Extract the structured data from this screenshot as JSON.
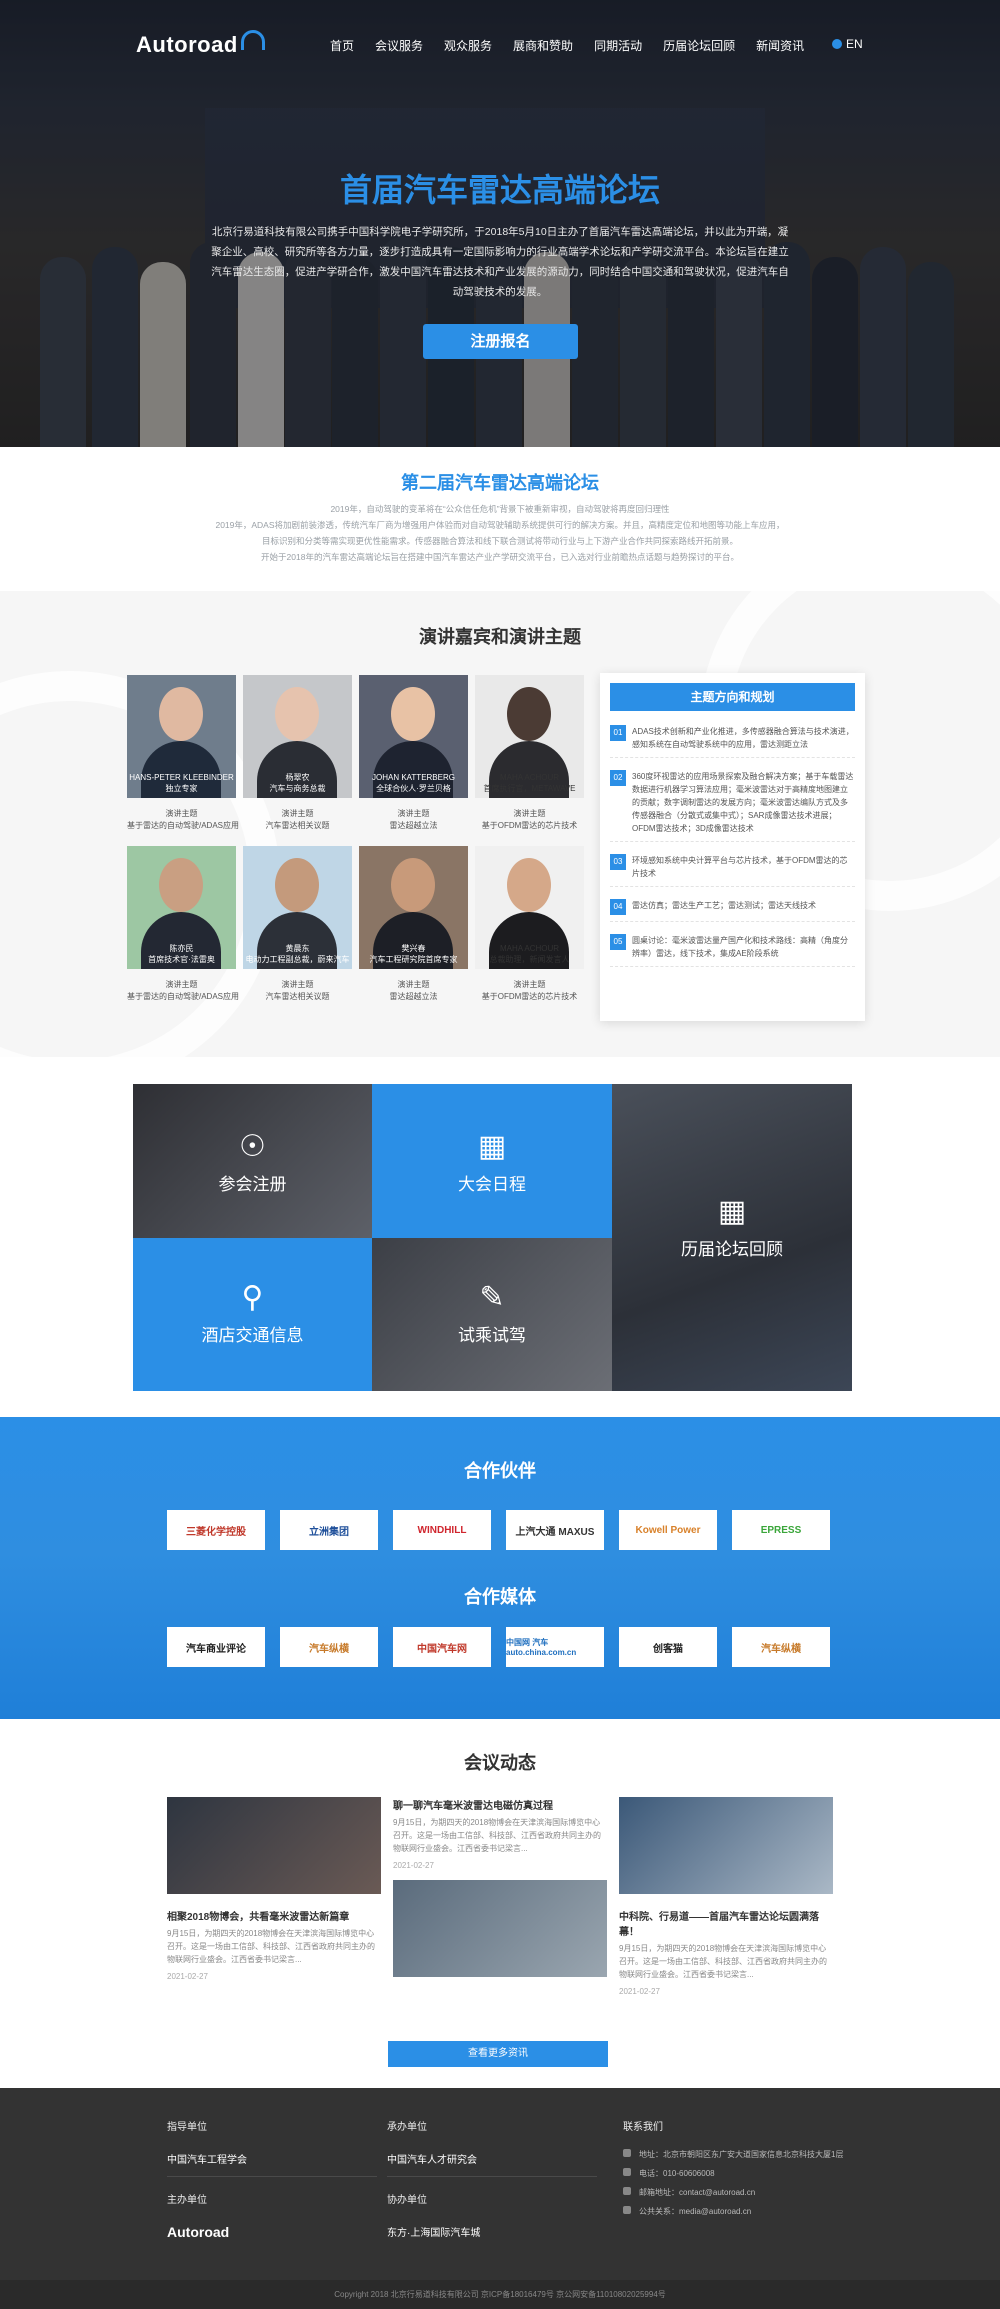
{
  "nav": {
    "logo": "Autoroad",
    "items": [
      "首页",
      "会议服务",
      "观众服务",
      "展商和赞助",
      "同期活动",
      "历届论坛回顾",
      "新闻资讯"
    ],
    "lang": "EN"
  },
  "hero": {
    "title": "首届汽车雷达高端论坛",
    "desc": "北京行易道科技有限公司携手中国科学院电子学研究所，于2018年5月10日主办了首届汽车雷达高端论坛，并以此为开端，凝聚企业、高校、研究所等各方力量，逐步打造成具有一定国际影响力的行业高端学术论坛和产学研交流平台。本论坛旨在建立汽车雷达生态圈，促进产学研合作，激发中国汽车雷达技术和产业发展的源动力，同时结合中国交通和驾驶状况，促进汽车自动驾驶技术的发展。",
    "button": "注册报名"
  },
  "second": {
    "title": "第二届汽车雷达高端论坛",
    "lines": [
      "2019年，自动驾驶的变革将在“公众信任危机”背景下被重新审视，自动驾驶将再度回归理性",
      "2019年，ADAS将加剧前装渗透，传统汽车厂商为增强用户体验而对自动驾驶辅助系统提供可行的解决方案。并且，高精度定位和地图等功能上车应用，",
      "目标识别和分类等需实现更优性能需求。传感器融合算法和线下联合测试将带动行业与上下游产业合作共同探索路线开拓前景。",
      "开始于2018年的汽车雷达高端论坛旨在搭建中国汽车雷达产业产学研交流平台，已入选对行业前瞻热点话题与趋势探讨的平台。"
    ]
  },
  "speakers": {
    "title": "演讲嘉宾和演讲主题",
    "list": [
      {
        "name": "HANS-PETER KLEEBINDER",
        "role": "独立专家",
        "m1": "演讲主题",
        "m2": "基于雷达的自动驾驶/ADAS应用"
      },
      {
        "name": "杨翠农",
        "role": "汽车与商务总裁",
        "m1": "演讲主题",
        "m2": "汽车雷达相关议题"
      },
      {
        "name": "JOHAN KATTERBERG",
        "role": "全球合伙人·罗兰贝格",
        "m1": "演讲主题",
        "m2": "雷达超越立法"
      },
      {
        "name": "MAHA ACHOUR",
        "role": "首席执行官，METAWAVE",
        "m1": "演讲主题",
        "m2": "基于OFDM雷达的芯片技术"
      },
      {
        "name": "陈亦民",
        "role": "首席技术官·法雷奥",
        "m1": "演讲主题",
        "m2": "基于雷达的自动驾驶/ADAS应用"
      },
      {
        "name": "黄晨东",
        "role": "电动力工程副总裁，蔚来汽车",
        "m1": "演讲主题",
        "m2": "汽车雷达相关议题"
      },
      {
        "name": "樊兴春",
        "role": "汽车工程研究院首席专家",
        "m1": "演讲主题",
        "m2": "雷达超越立法"
      },
      {
        "name": "MAHA ACHOUR",
        "role": "总裁助理，新闻发言人",
        "m1": "演讲主题",
        "m2": "基于OFDM雷达的芯片技术"
      }
    ],
    "topics_title": "主题方向和规划",
    "topics": [
      {
        "num": "01",
        "text": "ADAS技术创新和产业化推进，多传感器融合算法与技术演进，感知系统在自动驾驶系统中的应用，雷达测距立法"
      },
      {
        "num": "02",
        "text": "360度环视雷达的应用场景探索及融合解决方案；基于车载雷达数据进行机器学习算法应用；毫米波雷达对于高精度地图建立的贡献；数字调制雷达的发展方向；毫米波雷达编队方式及多传感器融合（分散式或集中式）；SAR成像雷达技术进展；OFDM雷达技术；3D成像雷达技术"
      },
      {
        "num": "03",
        "text": "环境感知系统中央计算平台与芯片技术，基于OFDM雷达的芯片技术"
      },
      {
        "num": "04",
        "text": "雷达仿真；雷达生产工艺；雷达测试；雷达天线技术"
      },
      {
        "num": "05",
        "text": "圆桌讨论：毫米波雷达量产国产化和技术路线：高精（角度分辨率）雷达，线下技术，集成AE阶段系统"
      }
    ]
  },
  "tiles": {
    "register": "参会注册",
    "schedule": "大会日程",
    "review": "历届论坛回顾",
    "hotel": "酒店交通信息",
    "testdrive": "试乘试驾"
  },
  "partners": {
    "title": "合作伙伴",
    "logos": [
      "三菱化学控股",
      "立洲集团",
      "WINDHILL",
      "上汽大通 MAXUS",
      "Kowell Power",
      "EPRESS"
    ],
    "media_title": "合作媒体",
    "media": [
      "汽车商业评论",
      "汽车纵横",
      "中国汽车网",
      "中国网 汽车 auto.china.com.cn",
      "创客猫",
      "汽车纵横"
    ]
  },
  "news": {
    "title": "会议动态",
    "items": [
      {
        "title": "相聚2018物博会，共看毫米波雷达新篇章",
        "summary": "9月15日，为期四天的2018物博会在天津滨海国际博览中心召开。这是一场由工信部、科技部、江西省政府共同主办的物联网行业盛会。江西省委书记梁言...",
        "date": "2021-02-27"
      },
      {
        "title": "聊一聊汽车毫米波雷达电磁仿真过程",
        "summary": "9月15日，为期四天的2018物博会在天津滨海国际博览中心召开。这是一场由工信部、科技部、江西省政府共同主办的物联网行业盛会。江西省委书记梁言...",
        "date": "2021-02-27"
      },
      {
        "title": "中科院、行易道——首届汽车雷达论坛圆满落幕！",
        "summary": "9月15日，为期四天的2018物博会在天津滨海国际博览中心召开。这是一场由工信部、科技部、江西省政府共同主办的物联网行业盛会。江西省委书记梁言...",
        "date": "2021-02-27"
      }
    ],
    "more": "查看更多资讯"
  },
  "footer": {
    "guide": "指导单位",
    "guide_org": "中国汽车工程学会",
    "host": "承办单位",
    "host_org": "中国汽车人才研究会",
    "contact": "联系我们",
    "address": "地址：北京市朝阳区东广安大道国家信息北京科技大厦1层",
    "phone": "电话：010-60606008",
    "email": "邮箱地址：contact@autoroad.cn",
    "public": "公共关系：media@autoroad.cn",
    "organizer": "主办单位",
    "organizer_logo": "Autoroad",
    "co": "协办单位",
    "co_org": "东方·上海国际汽车城",
    "copyright": "Copyright 2018 北京行易道科技有限公司 京ICP备18016479号 京公网安备11010802025994号"
  }
}
